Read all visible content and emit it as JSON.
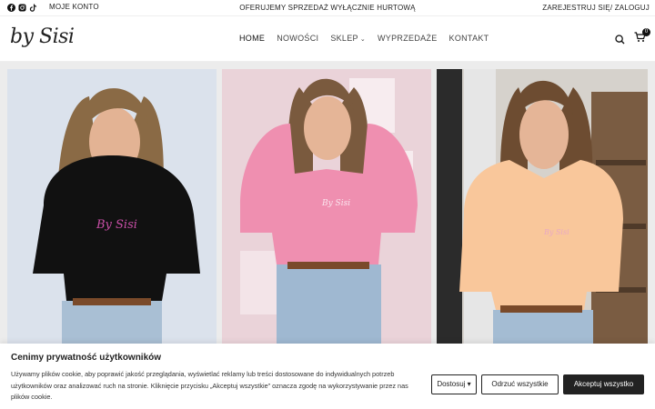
{
  "topbar": {
    "social": [
      "facebook-icon",
      "instagram-icon",
      "tiktok-icon"
    ],
    "account_link": "MOJE KONTO",
    "announcement": "OFERUJEMY SPRZEDAŻ WYŁĄCZNIE HURTOWĄ",
    "auth_link": "ZAREJESTRUJ SIĘ/ ZALOGUJ"
  },
  "header": {
    "logo": "by Sisi",
    "nav": [
      "HOME",
      "NOWOŚCI",
      "SKLEP",
      "WYPRZEDAŻE",
      "KONTAKT"
    ],
    "cart_count": "0"
  },
  "gallery": {
    "photos": [
      {
        "name": "model-black-hoodie",
        "logo_text": "By Sisi"
      },
      {
        "name": "model-pink-hoodie",
        "logo_text": "By Sisi"
      },
      {
        "name": "model-peach-hoodie",
        "logo_text": "By Sisi"
      }
    ]
  },
  "cookie": {
    "title": "Cenimy prywatność użytkowników",
    "text": "Używamy plików cookie, aby poprawić jakość przeglądania, wyświetlać reklamy lub treści dostosowane do indywidualnych potrzeb użytkowników oraz analizować ruch na stronie. Kliknięcie przycisku „Akceptuj wszystkie” oznacza zgodę na wykorzystywanie przez nas plików cookie.",
    "customize": "Dostosuj",
    "reject": "Odrzuć wszystkie",
    "accept": "Akceptuj wszystko"
  },
  "colors": {
    "text": "#222222",
    "accent": "#222222",
    "badge": "#111111"
  }
}
